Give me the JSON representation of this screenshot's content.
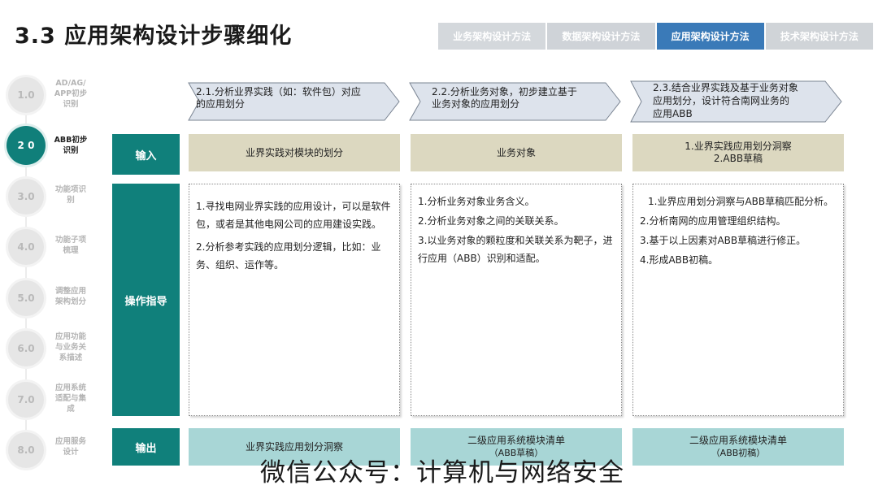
{
  "title": "3.3 应用架构设计步骤细化",
  "tabs": [
    {
      "label": "业务架构设计方法"
    },
    {
      "label": "数据架构设计方法"
    },
    {
      "label": "应用架构设计方法"
    },
    {
      "label": "技术架构设计方法"
    }
  ],
  "steps": [
    {
      "num": "1.0",
      "label": "AD/AG/\nAPP初步\n识别"
    },
    {
      "num": "2 0",
      "label": "ABB初步\n识别"
    },
    {
      "num": "3.0",
      "label": "功能项识\n别"
    },
    {
      "num": "4.0",
      "label": "功能子项\n梳理"
    },
    {
      "num": "5.0",
      "label": "调整应用\n架构划分"
    },
    {
      "num": "6.0",
      "label": "应用功能\n与业务关\n系描述"
    },
    {
      "num": "7.0",
      "label": "应用系统\n适配与集\n成"
    },
    {
      "num": "8.0",
      "label": "应用服务\n设计"
    }
  ],
  "arrows": [
    {
      "text": "2.1.分析业界实践（如：软件包）对应\n的应用划分"
    },
    {
      "text": "2.2.分析业务对象，初步建立基于\n业务对象的应用划分"
    },
    {
      "text": "2.3.结合业界实践及基于业务对象\n应用划分，设计符合南网业务的\n应用ABB"
    }
  ],
  "rows": {
    "input_label": "输入",
    "operation_label": "操作指导",
    "output_label": "输出"
  },
  "inputs": [
    {
      "text": "业界实践对模块的划分"
    },
    {
      "text": "业务对象"
    },
    {
      "text": "1.业界实践应用划分洞察\n2.ABB草稿"
    }
  ],
  "operations": [
    {
      "items": [
        "1.寻找电网业界实践的应用设计，可以是软件包，或者是其他电网公司的应用建设实践。",
        "2.分析参考实践的应用划分逻辑，比如：业务、组织、运作等。"
      ]
    },
    {
      "items": [
        "1.分析业务对象业务含义。",
        "2.分析业务对象之间的关联关系。",
        "3.以业务对象的颗粒度和关联关系为靶子，进行应用（ABB）识别和适配。"
      ]
    },
    {
      "items": [
        "1.业界应用划分洞察与ABB草稿匹配分析。",
        "2.分析南网的应用管理组织结构。",
        "3.基于以上因素对ABB草稿进行修正。",
        "4.形成ABB初稿。"
      ]
    }
  ],
  "outputs": [
    {
      "main": "业界实践应用划分洞察",
      "sub": ""
    },
    {
      "main": "二级应用系统模块清单",
      "sub": "（ABB草稿）"
    },
    {
      "main": "二级应用系统模块清单",
      "sub": "（ABB初稿）"
    }
  ],
  "watermark": "微信公众号：计算机与网络安全",
  "colors": {
    "teal": "#107f7a",
    "tab_active": "#3a7ab8",
    "tab_inactive": "#d4d8dc",
    "input_bg": "#dcd8c0",
    "output_bg": "#a8d6d6"
  }
}
